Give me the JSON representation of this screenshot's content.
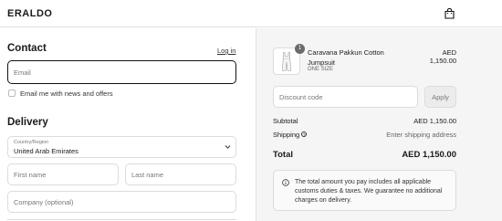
{
  "header": {
    "logo": "ERALDO",
    "cart_icon": "shopping-bag-icon"
  },
  "contact": {
    "title": "Contact",
    "login_link": "Log in",
    "email_placeholder": "Email",
    "newsletter_label": "Email me with news and offers",
    "newsletter_checked": false
  },
  "delivery": {
    "title": "Delivery",
    "country_caption": "Country/Region",
    "country_value": "United Arab Emirates",
    "first_name_placeholder": "First name",
    "last_name_placeholder": "Last name",
    "company_placeholder": "Company (optional)"
  },
  "summary": {
    "item": {
      "quantity": "1",
      "name": "Caravana Pakkun Cotton Jumpsuit",
      "variant": "ONE SIZE",
      "price": "AED 1,150.00"
    },
    "discount_placeholder": "Discount code",
    "apply_label": "Apply",
    "subtotal_label": "Subtotal",
    "subtotal_value": "AED 1,150.00",
    "shipping_label": "Shipping",
    "shipping_value": "Enter shipping address",
    "total_label": "Total",
    "total_value": "AED 1,150.00",
    "notice": "The total amount you pay includes all applicable customs duties & taxes. We guarantee no additional charges on delivery."
  },
  "colors": {
    "border": "#dcdcdc",
    "panel_bg": "#f5f5f5",
    "text": "#1a1a1a"
  }
}
